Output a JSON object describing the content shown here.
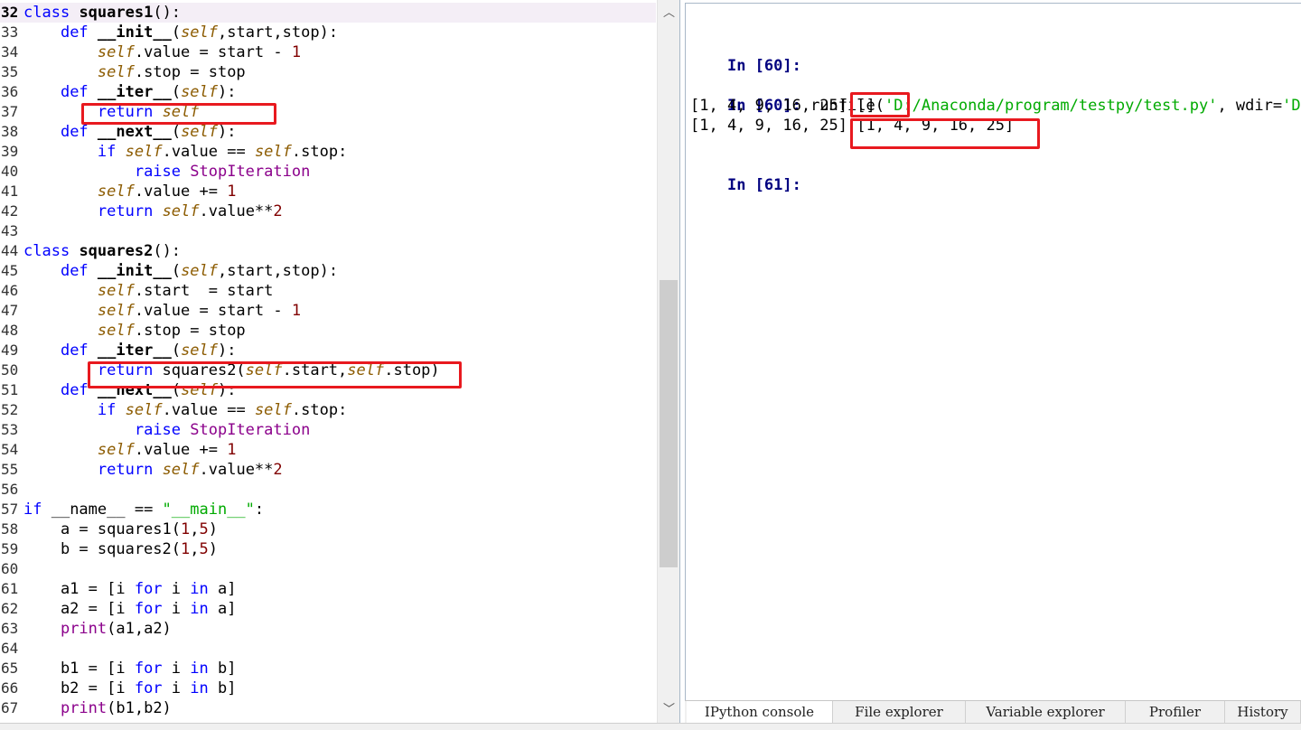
{
  "editor": {
    "lines": [
      {
        "no": "32",
        "html": "<span class=\"kw\">class</span> <span class=\"cls\">squares1</span>():"
      },
      {
        "no": "33",
        "html": "    <span class=\"kw\">def</span> <span class=\"fn\">__init__</span>(<span class=\"self\">self</span>,start,stop):"
      },
      {
        "no": "34",
        "html": "        <span class=\"self\">self</span>.value = start - <span class=\"num\">1</span>"
      },
      {
        "no": "35",
        "html": "        <span class=\"self\">self</span>.stop = stop"
      },
      {
        "no": "36",
        "html": "    <span class=\"kw\">def</span> <span class=\"fn\">__iter__</span>(<span class=\"self\">self</span>):"
      },
      {
        "no": "37",
        "html": "        <span class=\"kw\">return</span> <span class=\"self\">self</span>"
      },
      {
        "no": "38",
        "html": "    <span class=\"kw\">def</span> <span class=\"fn\">__next__</span>(<span class=\"self\">self</span>):"
      },
      {
        "no": "39",
        "html": "        <span class=\"kw\">if</span> <span class=\"self\">self</span>.value == <span class=\"self\">self</span>.stop:"
      },
      {
        "no": "40",
        "html": "            <span class=\"kw\">raise</span> <span class=\"bi\">StopIteration</span>"
      },
      {
        "no": "41",
        "html": "        <span class=\"self\">self</span>.value += <span class=\"num\">1</span>"
      },
      {
        "no": "42",
        "html": "        <span class=\"kw\">return</span> <span class=\"self\">self</span>.value**<span class=\"num\">2</span>"
      },
      {
        "no": "43",
        "html": ""
      },
      {
        "no": "44",
        "html": "<span class=\"kw\">class</span> <span class=\"cls\">squares2</span>():"
      },
      {
        "no": "45",
        "html": "    <span class=\"kw\">def</span> <span class=\"fn\">__init__</span>(<span class=\"self\">self</span>,start,stop):"
      },
      {
        "no": "46",
        "html": "        <span class=\"self\">self</span>.start  = start"
      },
      {
        "no": "47",
        "html": "        <span class=\"self\">self</span>.value = start - <span class=\"num\">1</span>"
      },
      {
        "no": "48",
        "html": "        <span class=\"self\">self</span>.stop = stop"
      },
      {
        "no": "49",
        "html": "    <span class=\"kw\">def</span> <span class=\"fn\">__iter__</span>(<span class=\"self\">self</span>):"
      },
      {
        "no": "50",
        "html": "        <span class=\"kw\">return</span> squares2(<span class=\"self\">self</span>.start,<span class=\"self\">self</span>.stop)"
      },
      {
        "no": "51",
        "html": "    <span class=\"kw\">def</span> <span class=\"fn\">__next__</span>(<span class=\"self\">self</span>):"
      },
      {
        "no": "52",
        "html": "        <span class=\"kw\">if</span> <span class=\"self\">self</span>.value == <span class=\"self\">self</span>.stop:"
      },
      {
        "no": "53",
        "html": "            <span class=\"kw\">raise</span> <span class=\"bi\">StopIteration</span>"
      },
      {
        "no": "54",
        "html": "        <span class=\"self\">self</span>.value += <span class=\"num\">1</span>"
      },
      {
        "no": "55",
        "html": "        <span class=\"kw\">return</span> <span class=\"self\">self</span>.value**<span class=\"num\">2</span>"
      },
      {
        "no": "56",
        "html": ""
      },
      {
        "no": "57",
        "html": "<span class=\"kw\">if</span> __name__ == <span class=\"str\">\"__main__\"</span>:"
      },
      {
        "no": "58",
        "html": "    a = squares1(<span class=\"num\">1</span>,<span class=\"num\">5</span>)"
      },
      {
        "no": "59",
        "html": "    b = squares2(<span class=\"num\">1</span>,<span class=\"num\">5</span>)"
      },
      {
        "no": "60",
        "html": ""
      },
      {
        "no": "61",
        "html": "    a1 = [i <span class=\"kw\">for</span> i <span class=\"kw\">in</span> a]"
      },
      {
        "no": "62",
        "html": "    a2 = [i <span class=\"kw\">for</span> i <span class=\"kw\">in</span> a]"
      },
      {
        "no": "63",
        "html": "    <span class=\"bi\">print</span>(a1,a2)"
      },
      {
        "no": "64",
        "html": ""
      },
      {
        "no": "65",
        "html": "    b1 = [i <span class=\"kw\">for</span> i <span class=\"kw\">in</span> b]"
      },
      {
        "no": "66",
        "html": "    b2 = [i <span class=\"kw\">for</span> i <span class=\"kw\">in</span> b]"
      },
      {
        "no": "67",
        "html": "    <span class=\"bi\">print</span>(b1,b2)"
      }
    ]
  },
  "console": {
    "prompt_60a": "In [60]:",
    "prompt_60b": "In [60]:",
    "runfile_cmd": " runfile(",
    "runfile_path": "'D:/Anaconda/program/testpy/test.py'",
    "runfile_wdir_key": ", wdir=",
    "runfile_wdir_val": "'D:/",
    "output_1": "[1, 4, 9, 16, 25] []",
    "output_2": "[1, 4, 9, 16, 25] [1, 4, 9, 16, 25]",
    "prompt_61": "In [61]:"
  },
  "tabs": [
    "IPython console",
    "File explorer",
    "Variable explorer",
    "Profiler",
    "History"
  ],
  "colors": {
    "highlight": "#e8191f",
    "keyword": "#0000ff",
    "self": "#8c5b00",
    "number": "#800000",
    "string": "#00aa00",
    "prompt": "#000080"
  }
}
